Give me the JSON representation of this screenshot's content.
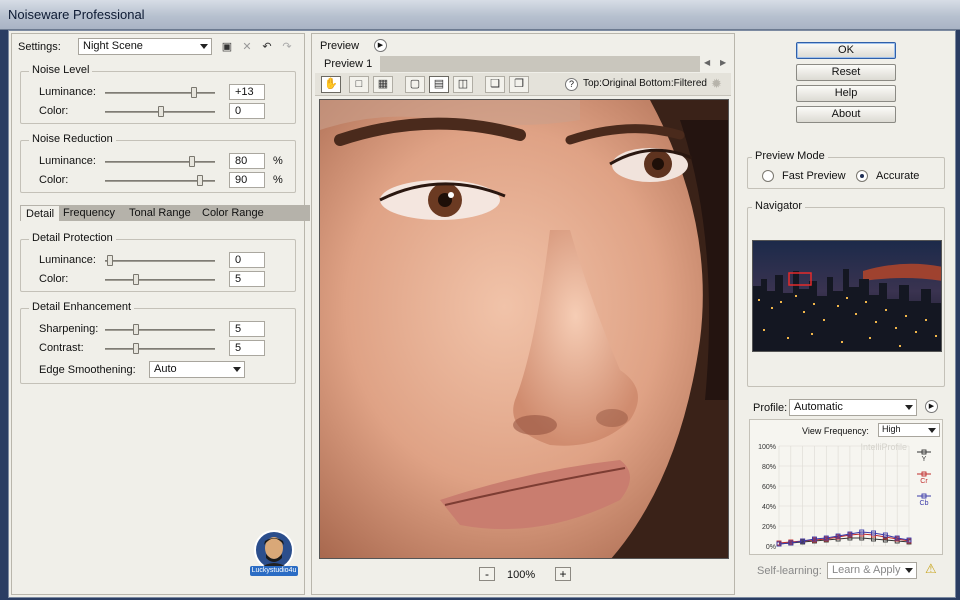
{
  "window": {
    "title": "Noiseware Professional"
  },
  "settings": {
    "label": "Settings:",
    "value": "Night Scene"
  },
  "noise_level": {
    "title": "Noise Level",
    "luminance": {
      "label": "Luminance:",
      "value": "+13"
    },
    "color": {
      "label": "Color:",
      "value": "0"
    }
  },
  "noise_reduction": {
    "title": "Noise Reduction",
    "luminance": {
      "label": "Luminance:",
      "value": "80",
      "unit": "%"
    },
    "color": {
      "label": "Color:",
      "value": "90",
      "unit": "%"
    }
  },
  "tabs": [
    "Detail",
    "Frequency",
    "Tonal Range",
    "Color Range"
  ],
  "detail_protection": {
    "title": "Detail Protection",
    "luminance": {
      "label": "Luminance:",
      "value": "0"
    },
    "color": {
      "label": "Color:",
      "value": "5"
    }
  },
  "detail_enhancement": {
    "title": "Detail Enhancement",
    "sharpening": {
      "label": "Sharpening:",
      "value": "5"
    },
    "contrast": {
      "label": "Contrast:",
      "value": "5"
    },
    "edge": {
      "label": "Edge Smoothening:",
      "value": "Auto"
    }
  },
  "watermark": {
    "text": "Luckystudio4u"
  },
  "preview": {
    "title": "Preview",
    "tab": "Preview 1",
    "split_info": "Top:Original Bottom:Filtered",
    "zoom": "100%",
    "zoom_minus": "-",
    "zoom_plus": "+"
  },
  "buttons": {
    "ok": "OK",
    "reset": "Reset",
    "help": "Help",
    "about": "About"
  },
  "preview_mode": {
    "title": "Preview Mode",
    "fast": "Fast Preview",
    "accurate": "Accurate"
  },
  "navigator": {
    "title": "Navigator"
  },
  "profile": {
    "label": "Profile:",
    "value": "Automatic",
    "view_frequency_label": "View Frequency:",
    "view_frequency": "High",
    "chart_watermark": "IntelliProfile",
    "self_learning_label": "Self-learning:",
    "self_learning": "Learn & Apply",
    "legend": [
      "Y",
      "Cr",
      "Cb"
    ],
    "colors": {
      "Y": "#333333",
      "Cr": "#c02a2a",
      "Cb": "#3a3aa8"
    }
  },
  "chart_data": {
    "type": "line",
    "title": "",
    "xlabel": "",
    "ylabel": "",
    "ylim": [
      0,
      100
    ],
    "yticks": [
      "0%",
      "20%",
      "40%",
      "60%",
      "80%",
      "100%"
    ],
    "x": [
      1,
      2,
      3,
      4,
      5,
      6,
      7,
      8,
      9,
      10,
      11,
      12
    ],
    "series": [
      {
        "name": "Y",
        "values": [
          2,
          3,
          4,
          5,
          6,
          7,
          8,
          8,
          7,
          6,
          5,
          4
        ]
      },
      {
        "name": "Cr",
        "values": [
          3,
          4,
          5,
          6,
          7,
          9,
          11,
          12,
          11,
          9,
          7,
          5
        ]
      },
      {
        "name": "Cb",
        "values": [
          2,
          3,
          5,
          7,
          8,
          10,
          12,
          14,
          13,
          11,
          8,
          6
        ]
      }
    ],
    "grid": true,
    "legend": "right"
  }
}
